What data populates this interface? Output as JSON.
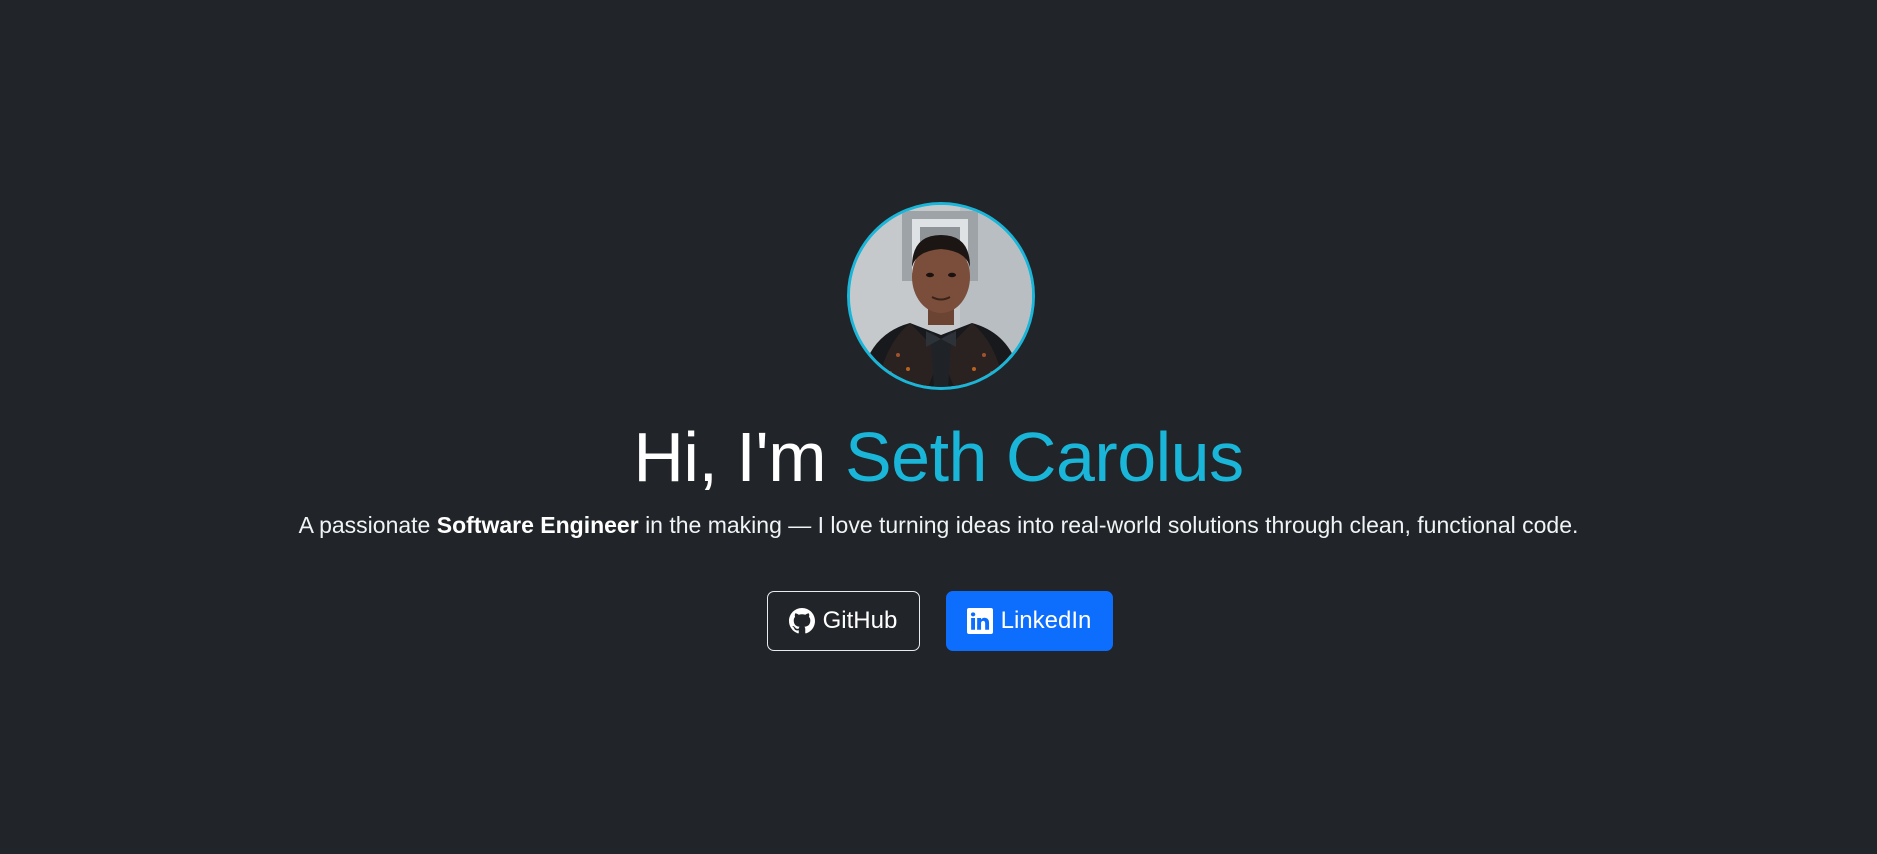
{
  "hero": {
    "greeting": "Hi, I'm",
    "name": "Seth Carolus",
    "tagline_before": "A passionate",
    "tagline_strong": "Software Engineer",
    "tagline_after": "in the making — I love turning ideas into real-world solutions through clean, functional code."
  },
  "avatar": {
    "icon": "profile-photo"
  },
  "buttons": {
    "github_label": "GitHub",
    "github_icon": "github-icon",
    "linkedin_label": "LinkedIn",
    "linkedin_icon": "linkedin-icon"
  },
  "colors": {
    "background": "#212529",
    "accent": "#1ab6d9",
    "primary": "#0d6efd",
    "text": "#ffffff"
  }
}
